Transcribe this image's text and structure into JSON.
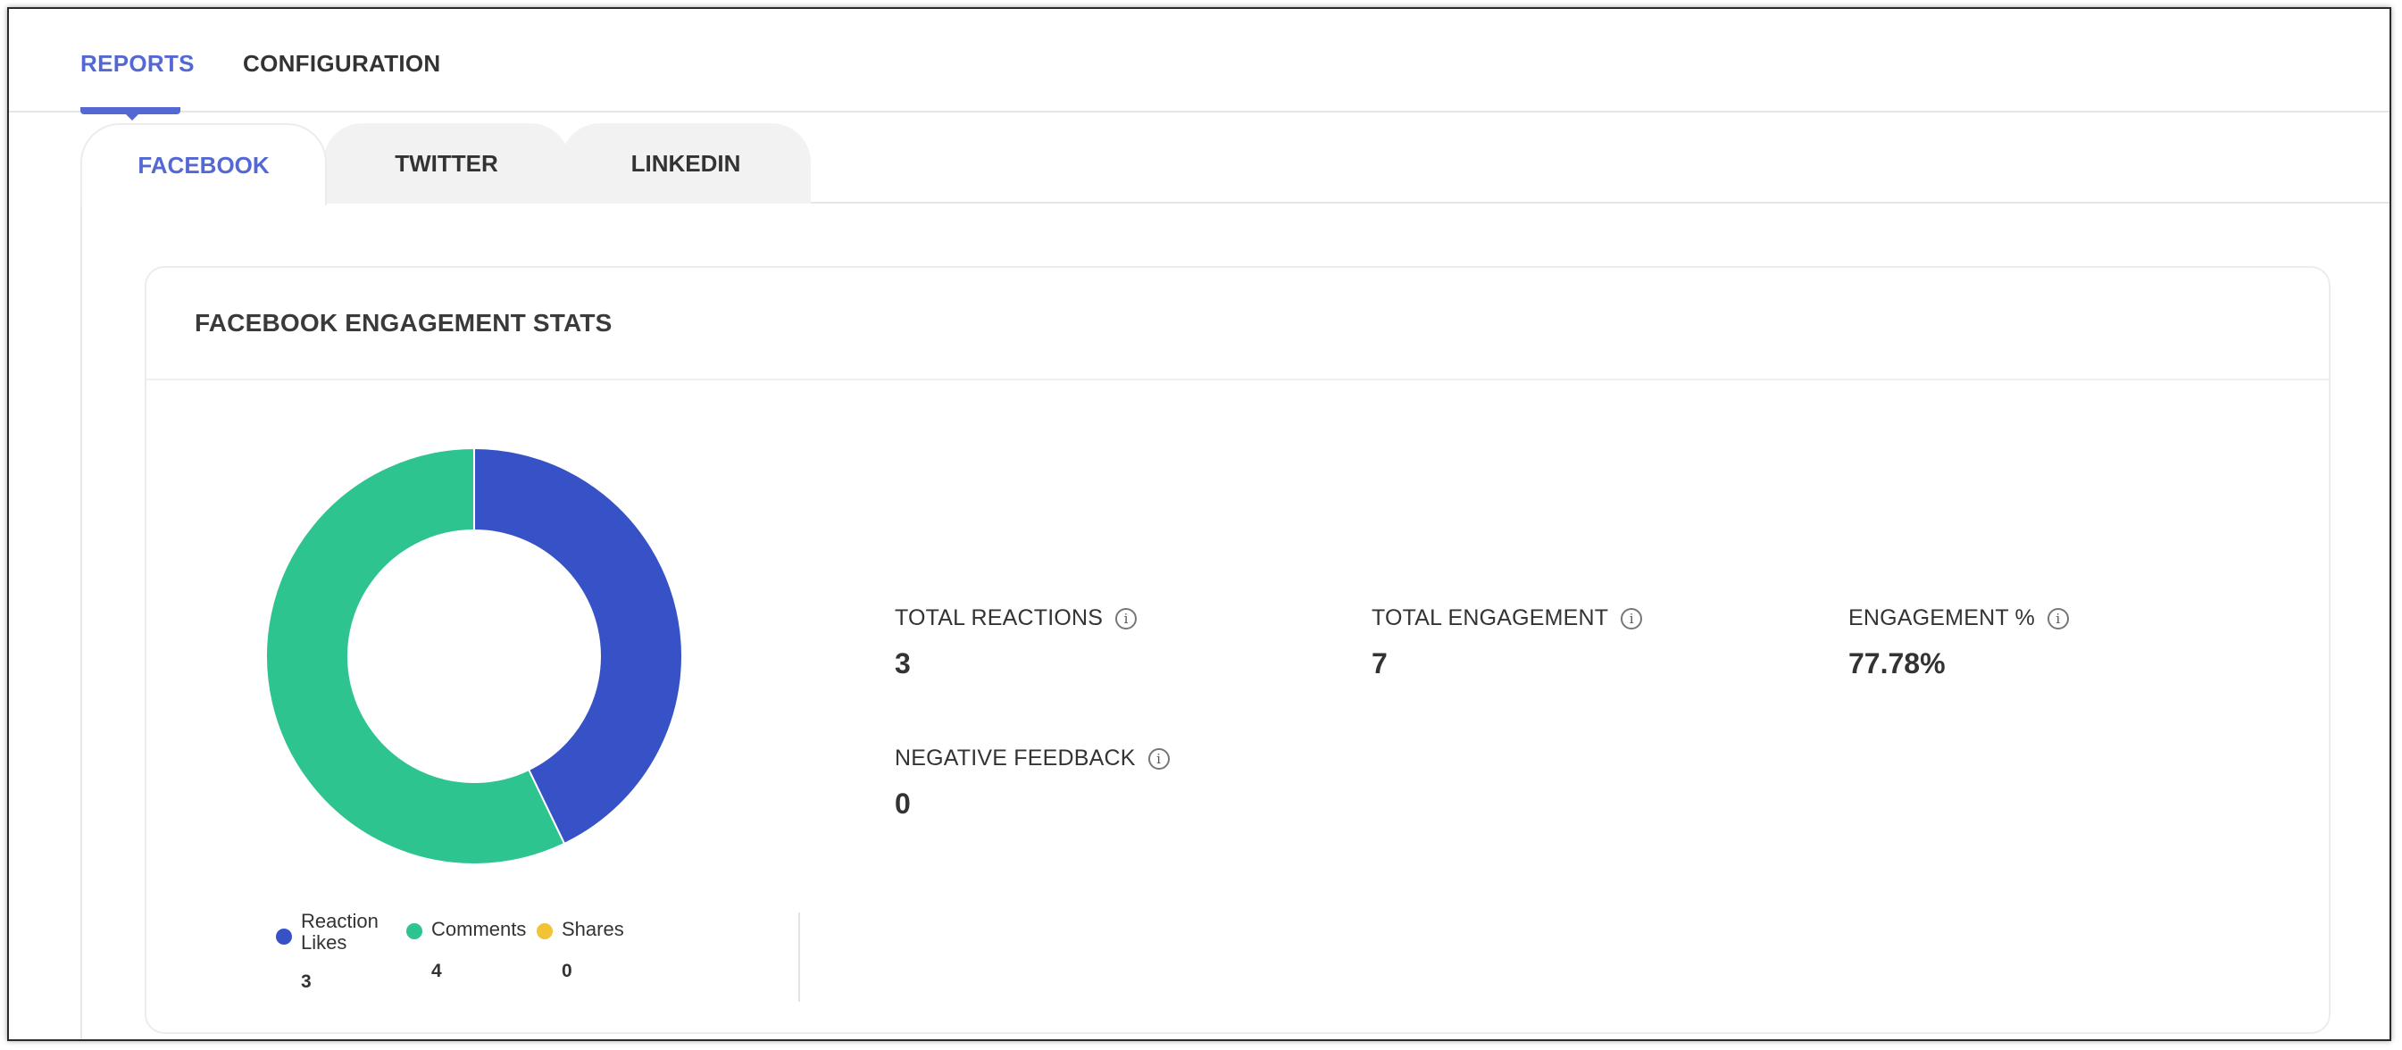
{
  "top_tabs": [
    {
      "label": "REPORTS",
      "active": true
    },
    {
      "label": "CONFIGURATION",
      "active": false
    }
  ],
  "sub_tabs": [
    {
      "label": "FACEBOOK",
      "active": true
    },
    {
      "label": "TWITTER",
      "active": false
    },
    {
      "label": "LINKEDIN",
      "active": false
    }
  ],
  "card": {
    "title": "FACEBOOK ENGAGEMENT STATS"
  },
  "chart_data": {
    "type": "pie",
    "donut": true,
    "title": "",
    "series": [
      {
        "name": "Reaction Likes",
        "value": 3,
        "color": "#3751c6"
      },
      {
        "name": "Comments",
        "value": 4,
        "color": "#2ec48f"
      },
      {
        "name": "Shares",
        "value": 0,
        "color": "#f2c237"
      }
    ]
  },
  "legend": [
    {
      "label": "Reaction Likes",
      "value": "3",
      "color": "#3751c6"
    },
    {
      "label": "Comments",
      "value": "4",
      "color": "#2ec48f"
    },
    {
      "label": "Shares",
      "value": "0",
      "color": "#f2c237"
    }
  ],
  "metrics": [
    {
      "label": "TOTAL REACTIONS",
      "value": "3"
    },
    {
      "label": "TOTAL ENGAGEMENT",
      "value": "7"
    },
    {
      "label": "ENGAGEMENT %",
      "value": "77.78%"
    },
    {
      "label": "NEGATIVE FEEDBACK",
      "value": "0"
    }
  ],
  "icons": {
    "info": "info-icon"
  },
  "colors": {
    "accent": "#5468d4"
  }
}
